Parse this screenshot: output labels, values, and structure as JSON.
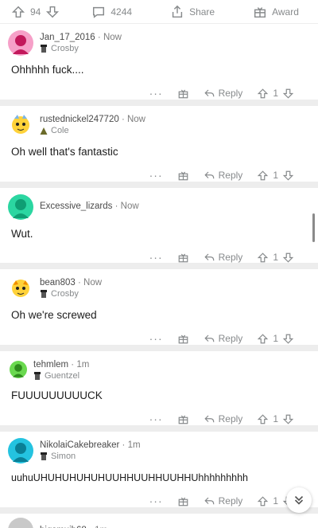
{
  "post_bar": {
    "score": "94",
    "comments": "4244",
    "share_label": "Share",
    "award_label": "Award"
  },
  "comments": [
    {
      "user": "Jan_17_2016",
      "time": "Now",
      "flair": "Crosby",
      "flair_icon": "phone-icon",
      "body": "Ohhhhh fuck....",
      "reply_label": "Reply",
      "score": "1",
      "avatar_color": "#f6a0c8"
    },
    {
      "user": "rustednickel247720",
      "time": "Now",
      "flair": "Cole",
      "flair_icon": "warning-icon",
      "body": "Oh well that's fantastic",
      "reply_label": "Reply",
      "score": "1",
      "avatar_color": "#ffd23a"
    },
    {
      "user": "Excessive_lizards",
      "time": "Now",
      "flair": "",
      "flair_icon": "",
      "body": "Wut.",
      "reply_label": "Reply",
      "score": "1",
      "avatar_color": "#2bd6a1"
    },
    {
      "user": "bean803",
      "time": "Now",
      "flair": "Crosby",
      "flair_icon": "phone-icon",
      "body": "Oh we're screwed",
      "reply_label": "Reply",
      "score": "1",
      "avatar_color": "#ffd23a"
    },
    {
      "user": "tehmlem",
      "time": "1m",
      "flair": "Guentzel",
      "flair_icon": "phone-icon",
      "body": "FUUUUUUUUUCK",
      "reply_label": "Reply",
      "score": "1",
      "avatar_color": "#6ad94f"
    },
    {
      "user": "NikolaiCakebreaker",
      "time": "1m",
      "flair": "Simon",
      "flair_icon": "phone-icon",
      "body": "uuhuUHUHUHUHUHUUHHUUHHUUHHUhhhhhhhhh",
      "reply_label": "Reply",
      "score": "1",
      "avatar_color": "#24c3e0"
    }
  ],
  "partial_comment": {
    "user": "bigsmuib68",
    "time": "1m"
  },
  "icons": {
    "upvote": "upvote-arrow-icon",
    "downvote": "downvote-arrow-icon",
    "comment": "comment-bubble-icon",
    "share": "share-icon",
    "award": "award-gift-icon",
    "more": "more-dots-icon",
    "reply": "reply-arrow-icon",
    "scroll_down": "chevron-double-down-icon"
  }
}
